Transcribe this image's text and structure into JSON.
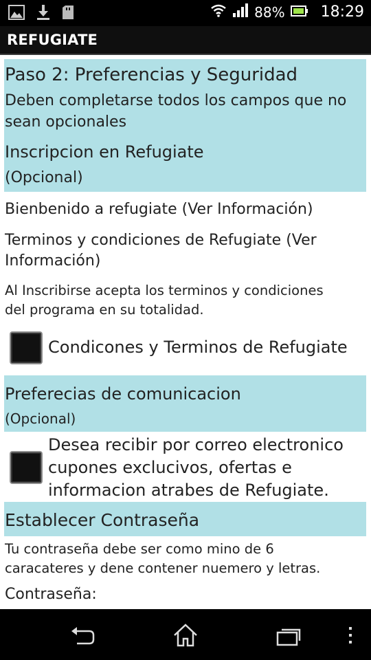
{
  "status_bar": {
    "battery_percent": "88%",
    "time": "18:29",
    "icons": [
      "image-icon",
      "download-icon",
      "sd-card-icon",
      "wifi-icon",
      "signal-icon",
      "battery-icon"
    ]
  },
  "app_bar": {
    "title": "REFUGIATE"
  },
  "step": {
    "title": "Paso 2: Preferencias y Seguridad",
    "subtitle_line1": "Deben completarse todos los campos que no",
    "subtitle_line2": "sean opcionales"
  },
  "registration": {
    "title": "Inscripcion en Refugiate",
    "optional": "(Opcional)",
    "welcome_link": "Bienbenido a refugiate (Ver Información)",
    "terms_link_line1": "Terminos y condiciones de Refugiate (Ver",
    "terms_link_line2": "Información)",
    "notice_line1": "Al Inscribirse acepta los terminos y condiciones",
    "notice_line2": "del programa en su totalidad.",
    "checkbox_label": "Condicones y Terminos de Refugiate"
  },
  "communication": {
    "title": "Preferecias de comunicacion",
    "optional": "(Opcional)",
    "checkbox_line1": "Desea recibir por correo electronico",
    "checkbox_line2": "cupones exclucivos, ofertas e",
    "checkbox_line3": "informacion atrabes de Refugiate."
  },
  "password": {
    "title": "Establecer Contraseña",
    "hint_line1": "Tu contraseña debe ser como mino de 6",
    "hint_line2": "caracateres y dene contener nuemero y letras.",
    "field_label": "Contraseña:"
  },
  "nav_bar": {
    "buttons": [
      "back-icon",
      "home-icon",
      "recent-apps-icon",
      "menu-icon"
    ]
  },
  "colors": {
    "section_band": "#b1e0e6",
    "status_bar": "#000000",
    "title_bar": "#0f0f0f"
  }
}
